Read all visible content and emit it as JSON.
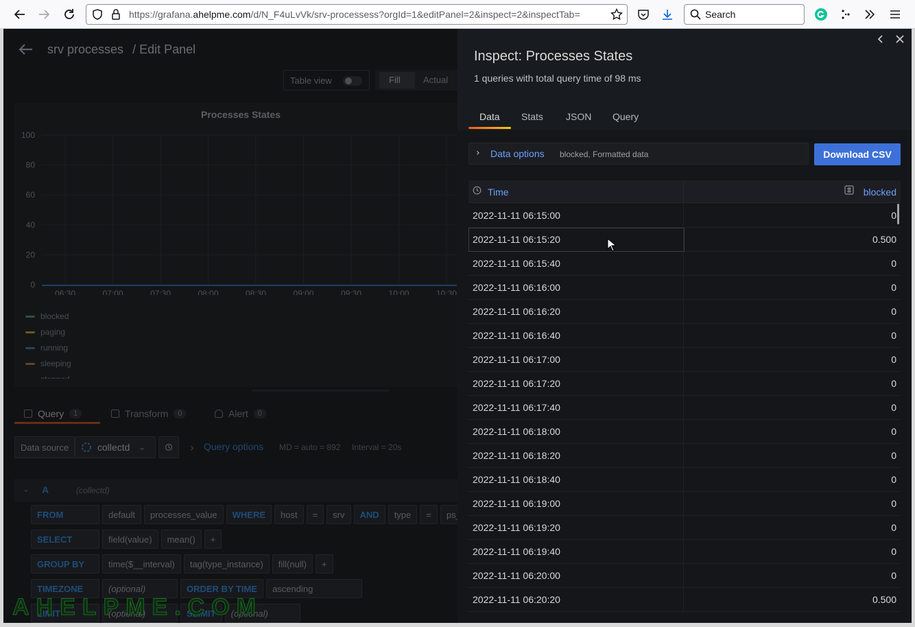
{
  "browser": {
    "url_prefix": "https://grafana.",
    "url_domain": "ahelpme.com",
    "url_rest": "/d/N_F4uLvVk/srv-processess?orgId=1&editPanel=2&inspect=2&inspectTab=",
    "search_placeholder": "Search"
  },
  "editor": {
    "breadcrumb_dashboard": "srv processes",
    "breadcrumb_page": "/ Edit Panel",
    "table_view_label": "Table view",
    "fill_label": "Fill",
    "actual_label": "Actual",
    "panel_title": "Processes States",
    "y_ticks": [
      "100",
      "80",
      "60",
      "40",
      "20",
      "0"
    ],
    "x_ticks": [
      "06:30",
      "07:00",
      "07:30",
      "08:00",
      "08:30",
      "09:00",
      "09:30",
      "10:00",
      "10:30"
    ],
    "legend": [
      {
        "name": "blocked",
        "color": "#73bf69"
      },
      {
        "name": "paging",
        "color": "#fade2a"
      },
      {
        "name": "running",
        "color": "#5794f2"
      },
      {
        "name": "sleeping",
        "color": "#ff9830"
      },
      {
        "name": "stopped",
        "color": "#f2495c"
      }
    ],
    "tabs": [
      {
        "label": "Query",
        "count": "1"
      },
      {
        "label": "Transform",
        "count": "0"
      },
      {
        "label": "Alert",
        "count": "0"
      }
    ],
    "datasource_label": "Data source",
    "datasource_value": "collectd",
    "query_options_label": "Query options",
    "query_options_md": "MD = auto = 892",
    "query_options_interval": "Interval = 20s",
    "query_letter": "A",
    "query_ds": "(collectd)",
    "rows": {
      "from": [
        "FROM",
        "default",
        "processes_value",
        "WHERE",
        "host",
        "=",
        "srv",
        "AND",
        "type",
        "=",
        "ps_state"
      ],
      "select": [
        "SELECT",
        "field(value)",
        "mean()",
        "+"
      ],
      "group": [
        "GROUP BY",
        "time($__interval)",
        "tag(type_instance)",
        "fill(null)",
        "+"
      ],
      "timezone": [
        "TIMEZONE",
        "(optional)",
        "ORDER BY TIME",
        "ascending"
      ],
      "limit": [
        "LIMIT",
        "(optional)",
        "SLIMIT",
        "(optional)"
      ]
    },
    "watermark": "AHELPME.COM"
  },
  "inspect": {
    "title": "Inspect: Processes States",
    "subtitle": "1 queries with total query time of 98 ms",
    "tabs": [
      "Data",
      "Stats",
      "JSON",
      "Query"
    ],
    "data_options_label": "Data options",
    "data_options_summary": "blocked, Formatted data",
    "download_label": "Download CSV",
    "columns": [
      "Time",
      "blocked"
    ],
    "rows": [
      [
        "2022-11-11 06:15:00",
        "0"
      ],
      [
        "2022-11-11 06:15:20",
        "0.500"
      ],
      [
        "2022-11-11 06:15:40",
        "0"
      ],
      [
        "2022-11-11 06:16:00",
        "0"
      ],
      [
        "2022-11-11 06:16:20",
        "0"
      ],
      [
        "2022-11-11 06:16:40",
        "0"
      ],
      [
        "2022-11-11 06:17:00",
        "0"
      ],
      [
        "2022-11-11 06:17:20",
        "0"
      ],
      [
        "2022-11-11 06:17:40",
        "0"
      ],
      [
        "2022-11-11 06:18:00",
        "0"
      ],
      [
        "2022-11-11 06:18:20",
        "0"
      ],
      [
        "2022-11-11 06:18:40",
        "0"
      ],
      [
        "2022-11-11 06:19:00",
        "0"
      ],
      [
        "2022-11-11 06:19:20",
        "0"
      ],
      [
        "2022-11-11 06:19:40",
        "0"
      ],
      [
        "2022-11-11 06:20:00",
        "0"
      ],
      [
        "2022-11-11 06:20:20",
        "0.500"
      ]
    ]
  }
}
